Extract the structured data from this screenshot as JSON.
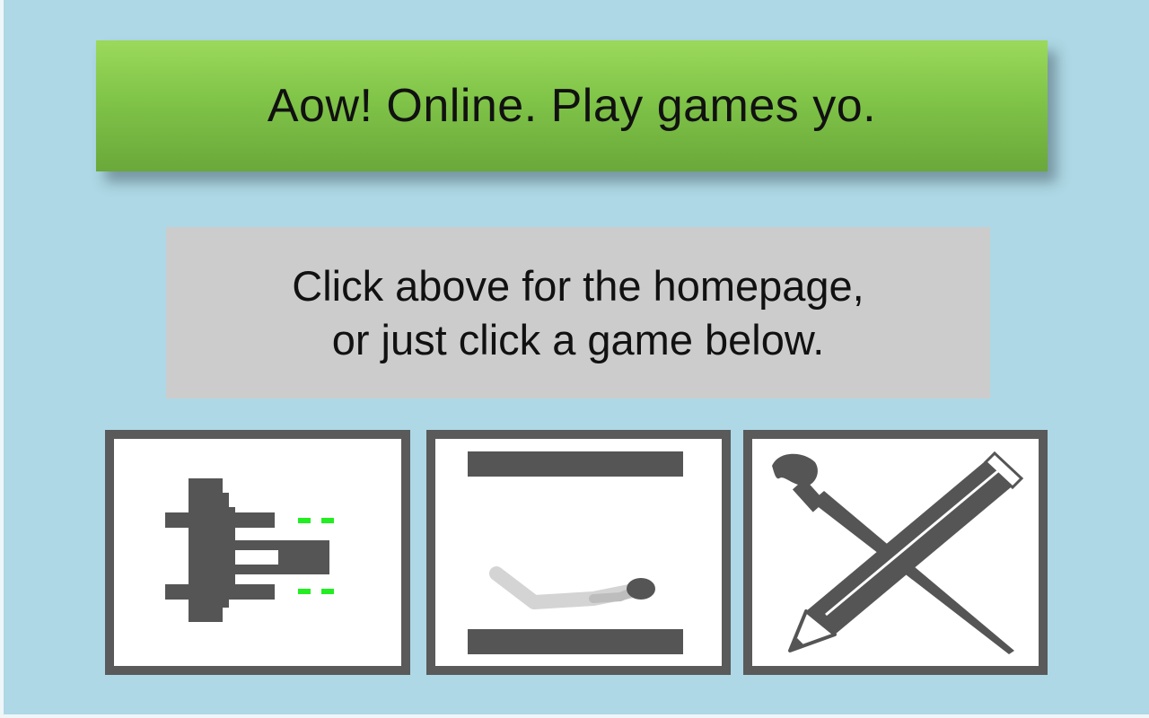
{
  "header": {
    "title": "Aow! Online. Play games yo."
  },
  "info": {
    "line1": "Click above for the homepage,",
    "line2": "or just click a game below."
  },
  "games": [
    {
      "icon": "shooter-game-icon"
    },
    {
      "icon": "paddle-ball-game-icon"
    },
    {
      "icon": "drawing-game-icon"
    }
  ],
  "colors": {
    "background": "#aed8e5",
    "banner_green": "#80c448",
    "info_gray": "#cccccc",
    "tile_border": "#5a5a5a",
    "icon_gray": "#555555",
    "laser_green": "#22ee22"
  }
}
